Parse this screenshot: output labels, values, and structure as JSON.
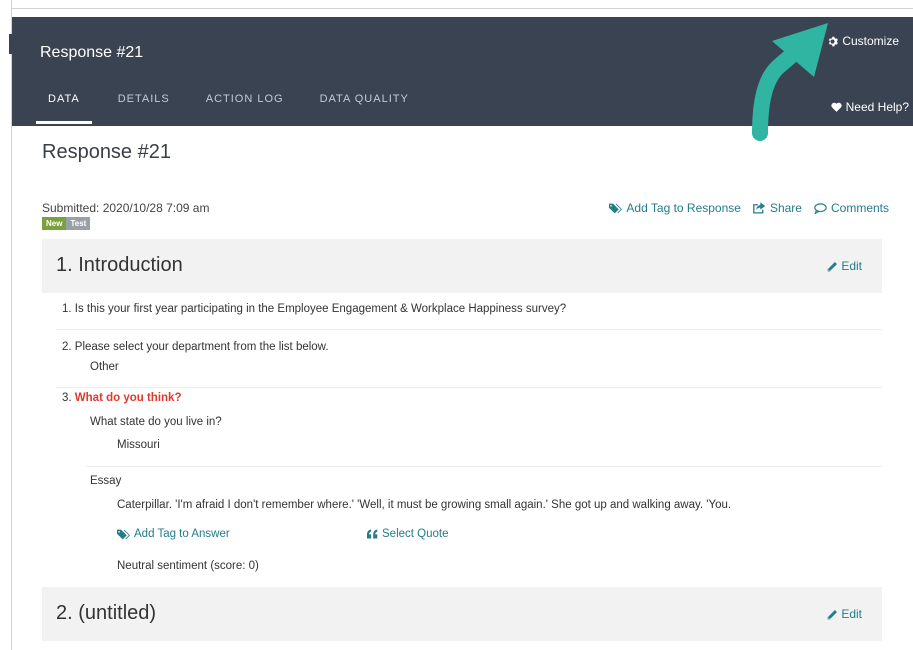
{
  "header": {
    "title": "Response #21",
    "customize": "Customize",
    "need_help": "Need Help?"
  },
  "tabs": [
    {
      "label": "DATA",
      "active": true
    },
    {
      "label": "DETAILS"
    },
    {
      "label": "ACTION LOG"
    },
    {
      "label": "DATA QUALITY"
    }
  ],
  "page": {
    "title": "Response #21",
    "submitted": "Submitted: 2020/10/28 7:09 am",
    "badges": {
      "new": "New",
      "test": "Test"
    },
    "actions": {
      "add_tag": "Add Tag to Response",
      "share": "Share",
      "comments": "Comments"
    }
  },
  "sections": [
    {
      "title": "1. Introduction",
      "edit": "Edit"
    },
    {
      "title": "2. (untitled)",
      "edit": "Edit"
    }
  ],
  "questions": {
    "q1": "1. Is this your first year participating in the Employee Engagement & Workplace Happiness survey?",
    "q2": "2. Please select your department from the list below.",
    "q2_answer": "Other",
    "q3_num": "3.",
    "q3_title": "What do you think?",
    "sub1_label": "What state do you live in?",
    "sub1_answer": "Missouri",
    "sub2_label": "Essay",
    "sub2_answer": "Caterpillar. 'I'm afraid I don't remember where.' 'Well, it must be growing small again.' She got up and walking away. 'You.",
    "add_tag_answer": "Add Tag to Answer",
    "select_quote": "Select Quote",
    "sentiment": "Neutral sentiment (score: 0)"
  },
  "colors": {
    "header_bg": "#3a4352",
    "link": "#257c8a",
    "arrow": "#2fb5a1",
    "required": "#e0392b",
    "badge_new": "#7aa13d",
    "badge_test": "#9aa0a6"
  }
}
